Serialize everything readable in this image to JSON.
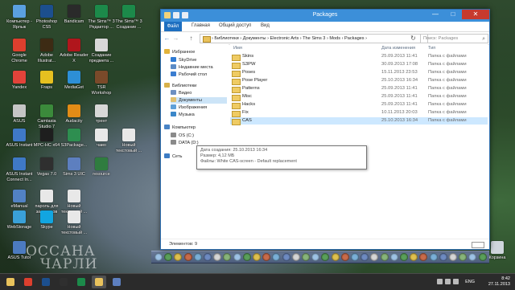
{
  "desktop": {
    "icons": [
      {
        "label": "Компьютер - Ярлык",
        "name": "desktop-icon-computer",
        "color": "#5aa0e0"
      },
      {
        "label": "Photoshop CS5",
        "name": "desktop-icon-photoshop",
        "color": "#1c4f8e"
      },
      {
        "label": "Bandicam",
        "name": "desktop-icon-bandicam",
        "color": "#2a2a2a"
      },
      {
        "label": "The Sims™ 3 Редактор ...",
        "name": "desktop-icon-sims3-editor",
        "color": "#1c8a4a"
      },
      {
        "label": "The Sims™ 3 Создание ...",
        "name": "desktop-icon-sims3-create",
        "color": "#1c8a4a"
      },
      {
        "label": "Google Chrome",
        "name": "desktop-icon-chrome",
        "color": "#dd3f2e"
      },
      {
        "label": "Adobe Illustrat...",
        "name": "desktop-icon-illustrator",
        "color": "#3d2b14"
      },
      {
        "label": "Adobe Reader X",
        "name": "desktop-icon-adobe-reader",
        "color": "#b0161c"
      },
      {
        "label": "Создание предмета ...",
        "name": "desktop-icon-create-item",
        "color": "#d8d8d8"
      },
      {
        "label": "Yandex",
        "name": "desktop-icon-yandex",
        "color": "#e2433a"
      },
      {
        "label": "Fraps",
        "name": "desktop-icon-fraps",
        "color": "#e6c020"
      },
      {
        "label": "MediaGet",
        "name": "desktop-icon-mediaget",
        "color": "#2d8fd6"
      },
      {
        "label": "TSR Workshop",
        "name": "desktop-icon-tsr-workshop",
        "color": "#7a4a2a"
      },
      {
        "label": "ASUS",
        "name": "desktop-icon-asus",
        "color": "#c5c5c5"
      },
      {
        "label": "Camtasia Studio 7",
        "name": "desktop-icon-camtasia",
        "color": "#3b8a3b"
      },
      {
        "label": "Audacity",
        "name": "desktop-icon-audacity",
        "color": "#e28c16"
      },
      {
        "label": "трент",
        "name": "desktop-icon-trent",
        "color": "#d8d8d8"
      },
      {
        "label": "ASUS Instant",
        "name": "desktop-icon-asus-instant",
        "color": "#3f79c6"
      },
      {
        "label": "MPC-HC x64",
        "name": "desktop-icon-mpc-hc",
        "color": "#1e1e1e"
      },
      {
        "label": "S3Package...",
        "name": "desktop-icon-s3package",
        "color": "#2e8e50"
      },
      {
        "label": "чаво",
        "name": "desktop-icon-chavo",
        "color": "#e8e8e8"
      },
      {
        "label": "Новый текстовый ...",
        "name": "desktop-icon-new-text-1",
        "color": "#e8e8e8"
      },
      {
        "label": "ASUS Instant Connect In...",
        "name": "desktop-icon-asus-connect",
        "color": "#3f79c6"
      },
      {
        "label": "Vegas 7.0",
        "name": "desktop-icon-vegas",
        "color": "#2f2f2f"
      },
      {
        "label": "Sims 3 UIC",
        "name": "desktop-icon-sims3-uic",
        "color": "#5d7fbf"
      },
      {
        "label": "resource",
        "name": "desktop-icon-resource",
        "color": "#2f7c3f"
      },
      {
        "label": "eManual",
        "name": "desktop-icon-emanual",
        "color": "#5282c4"
      },
      {
        "label": "пароль для замстеров",
        "name": "desktop-icon-password",
        "color": "#e8e8e8"
      },
      {
        "label": "Новый текстовый ...",
        "name": "desktop-icon-new-text-2",
        "color": "#e8e8e8"
      },
      {
        "label": "WebStorage",
        "name": "desktop-icon-webstorage",
        "color": "#3aa0d8"
      },
      {
        "label": "Skype",
        "name": "desktop-icon-skype",
        "color": "#12a5e0"
      },
      {
        "label": "Новый текстовый ...",
        "name": "desktop-icon-new-text-3",
        "color": "#e8e8e8"
      },
      {
        "label": "ASUS Tutor",
        "name": "desktop-icon-asus-tutor",
        "color": "#4c7bc0"
      },
      {
        "label": "Корзина",
        "name": "desktop-icon-recycle-bin",
        "color": "#cfd6dc"
      }
    ]
  },
  "window": {
    "title": "Packages",
    "min": "—",
    "max": "□",
    "close": "✕"
  },
  "ribbon": {
    "file": "Файл",
    "tabs": [
      "Главная",
      "Общий доступ",
      "Вид"
    ]
  },
  "address": {
    "back": "←",
    "forward": "→",
    "up": "↑",
    "path": "›  Библиотеки  ›  Документы  ›  Electronic Arts  ›  The Sims 3  ›  Mods  ›  Packages  ›",
    "refresh": "↻",
    "search_placeholder": "Поиск: Packages",
    "search_icon": "⌕"
  },
  "navpane": {
    "items": [
      {
        "label": "Избранное",
        "name": "nav-favorites",
        "icon": "star-icon",
        "color": "#e2b33a",
        "indent": 0
      },
      {
        "label": "SkyDrive",
        "name": "nav-skydrive",
        "icon": "cloud-icon",
        "color": "#2f7bd3",
        "indent": 1
      },
      {
        "label": "Недавние места",
        "name": "nav-recent-places",
        "icon": "recent-icon",
        "color": "#5b8bc6",
        "indent": 1
      },
      {
        "label": "Рабочий стол",
        "name": "nav-desktop",
        "icon": "desktop-icon",
        "color": "#3b7dd0",
        "indent": 1
      },
      {
        "label": "Библиотеки",
        "name": "nav-libraries",
        "icon": "library-icon",
        "color": "#d8b14a",
        "indent": 0
      },
      {
        "label": "Видео",
        "name": "nav-video",
        "icon": "video-icon",
        "color": "#6c8fc2",
        "indent": 1
      },
      {
        "label": "Документы",
        "name": "nav-documents",
        "icon": "documents-icon",
        "color": "#e0c070",
        "indent": 1
      },
      {
        "label": "Изображения",
        "name": "nav-pictures",
        "icon": "pictures-icon",
        "color": "#5fa0d8",
        "indent": 1
      },
      {
        "label": "Музыка",
        "name": "nav-music",
        "icon": "music-icon",
        "color": "#3b87c9",
        "indent": 1
      },
      {
        "label": "Компьютер",
        "name": "nav-computer",
        "icon": "computer-icon",
        "color": "#4a84c6",
        "indent": 0
      },
      {
        "label": "OS (C:)",
        "name": "nav-drive-c",
        "icon": "drive-icon",
        "color": "#8a8a8a",
        "indent": 1
      },
      {
        "label": "DATA (D:)",
        "name": "nav-drive-d",
        "icon": "drive-icon",
        "color": "#8a8a8a",
        "indent": 1
      },
      {
        "label": "Сеть",
        "name": "nav-network",
        "icon": "network-icon",
        "color": "#3d7cc4",
        "indent": 0
      }
    ]
  },
  "columns": {
    "name": "Имя",
    "date": "Дата изменения",
    "type": "Тип"
  },
  "files": [
    {
      "name": "Skins",
      "date": "25.09.2013 11:41",
      "type": "Папка с файлами"
    },
    {
      "name": "S3PW",
      "date": "30.09.2013 17:08",
      "type": "Папка с файлами"
    },
    {
      "name": "Poses",
      "date": "15.11.2013 23:53",
      "type": "Папка с файлами"
    },
    {
      "name": "Pose Player",
      "date": "25.10.2013 16:34",
      "type": "Папка с файлами"
    },
    {
      "name": "Patterns",
      "date": "25.09.2013 11:41",
      "type": "Папка с файлами"
    },
    {
      "name": "Misc",
      "date": "25.09.2013 11:41",
      "type": "Папка с файлами"
    },
    {
      "name": "Hacks",
      "date": "25.09.2013 11:41",
      "type": "Папка с файлами"
    },
    {
      "name": "Fix",
      "date": "10.11.2013 20:03",
      "type": "Папка с файлами"
    },
    {
      "name": "CAS",
      "date": "25.10.2013 16:34",
      "type": "Папка с файлами"
    }
  ],
  "tooltip": {
    "line1": "Дата создания: 25.10.2013 16:34",
    "line2": "Размер: 4,12 МБ",
    "line3": "Файлы: White CAS-screen - Default replacement"
  },
  "status": {
    "count": "Элементов: 9"
  },
  "watermark": {
    "line1": "ОССАНА",
    "line2": "ЧАРЛИ"
  },
  "taskbar": {
    "lang": "ENG",
    "time": "8:42",
    "date": "27.11.2013",
    "apps": [
      {
        "name": "taskbar-explorer-button",
        "icon": "folder-icon",
        "color": "#e9c25c",
        "active": false
      },
      {
        "name": "taskbar-chrome-button",
        "icon": "chrome-icon",
        "color": "#dd3f2e",
        "active": false
      },
      {
        "name": "taskbar-photoshop-button",
        "icon": "photoshop-icon",
        "color": "#1c4f8e",
        "active": false
      },
      {
        "name": "taskbar-bandicam-button",
        "icon": "bandicam-icon",
        "color": "#2f2f2f",
        "active": false
      },
      {
        "name": "taskbar-sims-button",
        "icon": "sims-icon",
        "color": "#1c8a4a",
        "active": false
      },
      {
        "name": "taskbar-folder-active-button",
        "icon": "folder-icon",
        "color": "#e9c25c",
        "active": true
      },
      {
        "name": "taskbar-app-button",
        "icon": "app-icon",
        "color": "#5d7fbf",
        "active": false
      }
    ]
  }
}
